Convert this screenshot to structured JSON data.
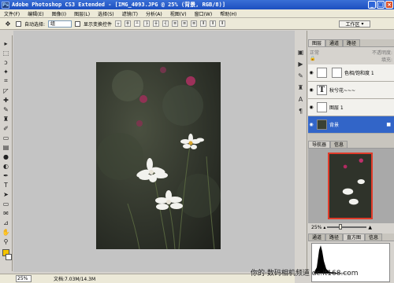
{
  "window": {
    "ps_logo": "Ps",
    "title": "Adobe Photoshop CS3 Extended - [IMG_4093.JPG @ 25% (背景, RGB/8)]",
    "buttons": {
      "minimize": "_",
      "maximize": "□",
      "close": "×"
    }
  },
  "menu": {
    "items": [
      "文件(F)",
      "编辑(E)",
      "图像(I)",
      "图层(L)",
      "选择(S)",
      "滤镜(T)",
      "分析(A)",
      "视图(V)",
      "窗口(W)",
      "帮助(H)"
    ]
  },
  "options": {
    "auto_select_label": "自动选择:",
    "auto_select_value": "组",
    "show_transform_label": "显示变换控件",
    "workspace_label": "工作区"
  },
  "layers": {
    "tabs": [
      "图层",
      "通道",
      "路径"
    ],
    "blend_mode": "正常",
    "opacity_label": "不透明度:",
    "fill_label": "填充:",
    "rows": [
      {
        "name": "色相/饱和度 1",
        "selected": false
      },
      {
        "name": "秋兮花~~~",
        "selected": false
      },
      {
        "name": "图层 1",
        "selected": false
      },
      {
        "name": "背景",
        "selected": true
      }
    ]
  },
  "navigator": {
    "tabs": [
      "导航器",
      "信息"
    ],
    "zoom": "25%"
  },
  "histogram": {
    "tabs": [
      "通道",
      "路径",
      "直方图",
      "信息"
    ]
  },
  "status": {
    "zoom": "25%",
    "doc_info": "文档:7.03M/14.3M"
  },
  "watermark": "你的·数码相机频道 dc.it168.com"
}
